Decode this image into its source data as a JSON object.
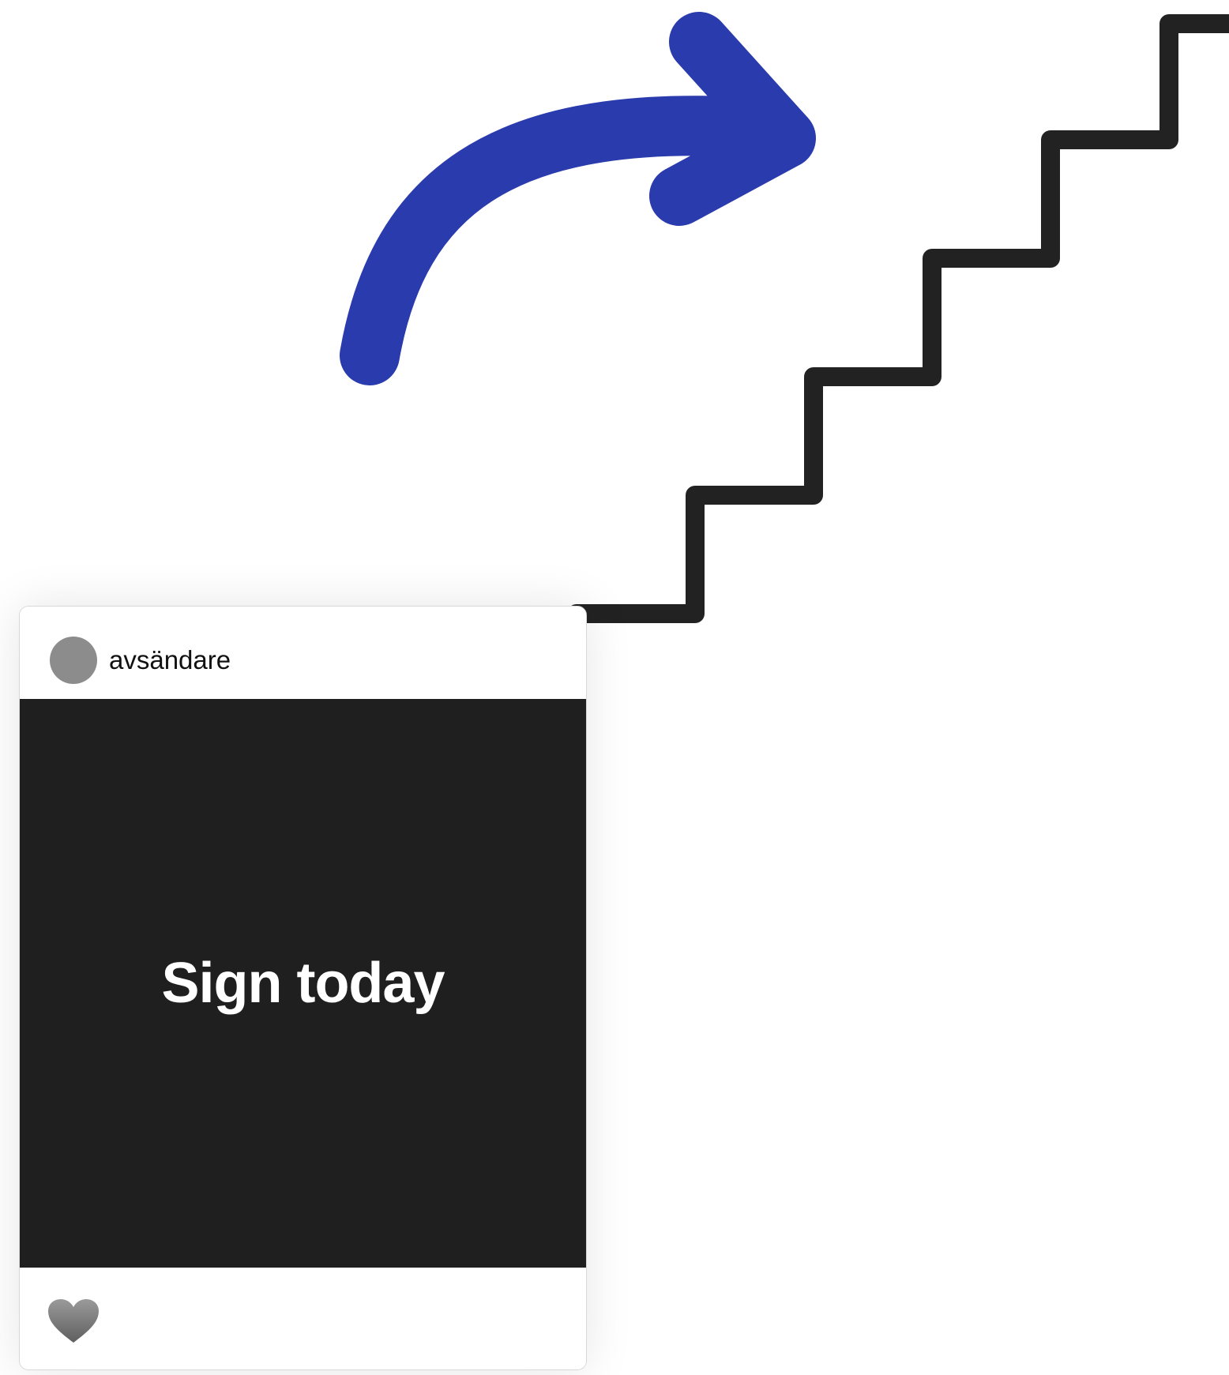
{
  "post": {
    "sender": "avsändare",
    "image_text": "Sign today",
    "like_icon": "heart-icon"
  },
  "decorations": {
    "arrow_icon": "curved-arrow-icon",
    "stairs_icon": "staircase-icon",
    "arrow_color": "#2a3bad",
    "stairs_color": "#222222",
    "image_background": "#1f1f1f",
    "avatar_color": "#8c8c8c"
  }
}
